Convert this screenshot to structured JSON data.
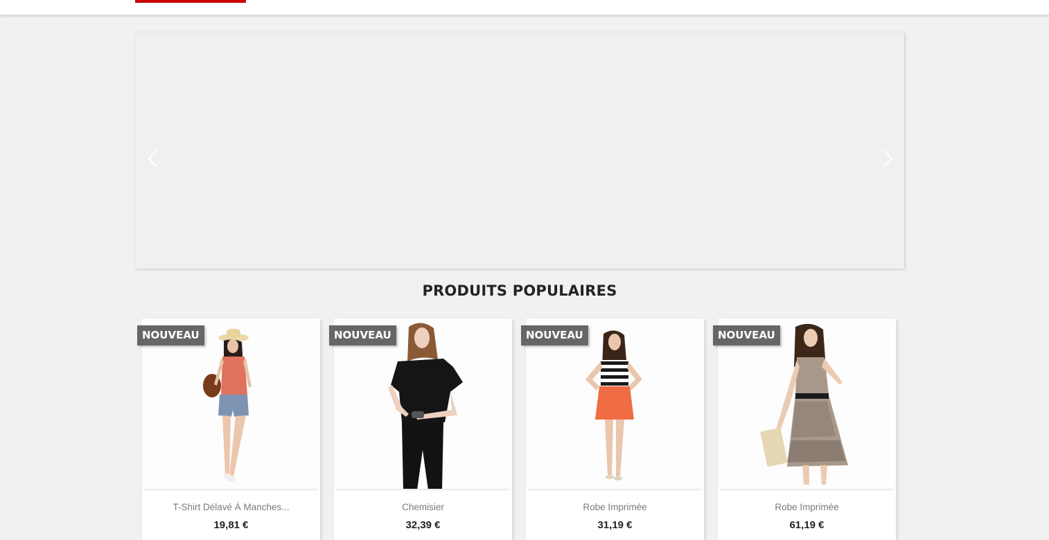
{
  "header": {
    "logo_color": "#d40000"
  },
  "slider": {
    "prev_icon": "chevron-left-icon",
    "next_icon": "chevron-right-icon"
  },
  "section": {
    "title": "PRODUITS POPULAIRES"
  },
  "products": [
    {
      "badge": "NOUVEAU",
      "name": "T-Shirt Délavé À Manches...",
      "price": "19,81 €",
      "image": "woman-straw-hat-orange-top-denim-shorts"
    },
    {
      "badge": "NOUVEAU",
      "name": "Chemisier",
      "price": "32,39 €",
      "image": "woman-black-blouse-black-pants"
    },
    {
      "badge": "NOUVEAU",
      "name": "Robe Imprimée",
      "price": "31,19 €",
      "image": "woman-striped-top-orange-skirt"
    },
    {
      "badge": "NOUVEAU",
      "name": "Robe Imprimée",
      "price": "61,19 €",
      "image": "woman-printed-dress-clutch"
    }
  ],
  "colors": {
    "badge_bg": "#666666",
    "page_bg": "#f1f1f1",
    "title": "#232323"
  }
}
